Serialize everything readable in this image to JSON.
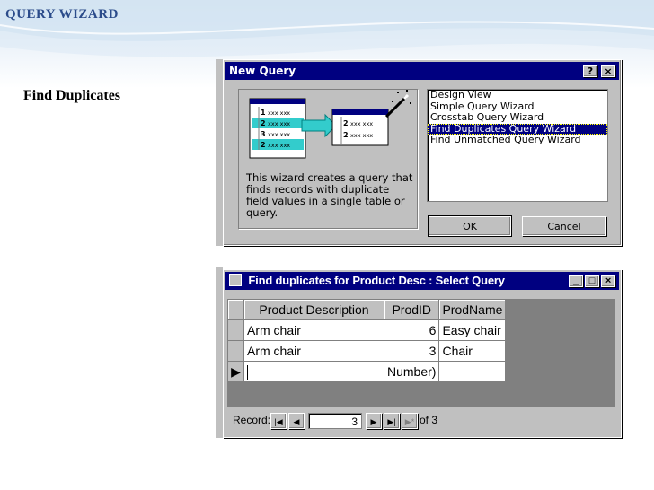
{
  "slide": {
    "title": "QUERY WIZARD",
    "subtitle": "Find Duplicates"
  },
  "new_query_dialog": {
    "title": "New Query",
    "help_button": "?",
    "close_button": "×",
    "description": "This wizard creates a query that finds records with duplicate field values in a single table or query.",
    "wizard_options": [
      "Design View",
      "Simple Query Wizard",
      "Crosstab Query Wizard",
      "Find Duplicates Query Wizard",
      "Find Unmatched Query Wizard"
    ],
    "selected_option": "Find Duplicates Query Wizard",
    "ok_label": "OK",
    "cancel_label": "Cancel",
    "preview_rows": [
      {
        "id": "1",
        "text": "xxx xxx"
      },
      {
        "id": "2",
        "text": "xxx xxx"
      },
      {
        "id": "3",
        "text": "xxx xxx"
      },
      {
        "id": "2",
        "text": "xxx xxx"
      }
    ],
    "preview_result_rows": [
      {
        "id": "2",
        "text": "xxx xxx"
      },
      {
        "id": "2",
        "text": "xxx xxx"
      }
    ]
  },
  "query_window": {
    "title": "Find duplicates for Product Desc : Select Query",
    "minimize": "_",
    "restore": "□",
    "close": "×",
    "columns": [
      "Product Description",
      "ProdID",
      "ProdName"
    ],
    "rows": [
      {
        "desc": "Arm chair",
        "id": "6",
        "name": "Easy chair"
      },
      {
        "desc": "Arm chair",
        "id": "3",
        "name": "Chair"
      }
    ],
    "new_row": {
      "desc": "",
      "id": "Number)",
      "name": ""
    },
    "record_label": "Record:",
    "current_record": "3",
    "of_label": "of",
    "total_records": "3"
  },
  "colors": {
    "title_text": "#2b4b8a",
    "titlebar": "#000080",
    "face": "#c0c0c0"
  }
}
